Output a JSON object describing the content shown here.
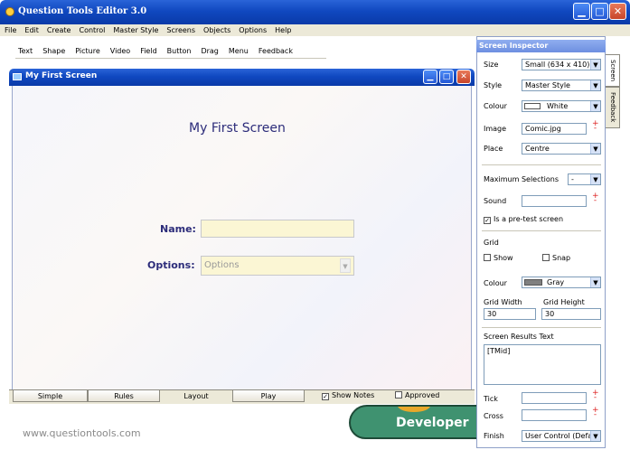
{
  "app": {
    "title": "Question Tools Editor 3.0",
    "menu": [
      "File",
      "Edit",
      "Create",
      "Control",
      "Master Style",
      "Screens",
      "Objects",
      "Options",
      "Help"
    ],
    "toolbar": [
      "Text",
      "Shape",
      "Picture",
      "Video",
      "Field",
      "Button",
      "Drag",
      "Menu",
      "Feedback"
    ]
  },
  "screen_window": {
    "title": "My First Screen",
    "heading": "My First Screen",
    "name_label": "Name:",
    "options_label": "Options:",
    "options_value": "Options",
    "tabs": [
      "Simple",
      "Rules",
      "Layout",
      "Play"
    ],
    "show_notes_label": "Show Notes",
    "show_notes_checked": true,
    "approved_label": "Approved",
    "approved_checked": false
  },
  "footer": {
    "url": "www.questiontools.com",
    "badge": "Developer"
  },
  "inspector": {
    "title": "Screen Inspector",
    "side_tabs": [
      "Screen",
      "Feedback"
    ],
    "size_label": "Size",
    "size_value": "Small (634 x 410)",
    "style_label": "Style",
    "style_value": "Master Style",
    "colour_label": "Colour",
    "colour_value": "White",
    "colour_swatch": "#ffffff",
    "image_label": "Image",
    "image_value": "Comic.jpg",
    "place_label": "Place",
    "place_value": "Centre",
    "max_sel_label": "Maximum Selections",
    "max_sel_value": "-",
    "sound_label": "Sound",
    "sound_value": "",
    "pretest_label": "Is a pre-test screen",
    "pretest_checked": true,
    "grid_label": "Grid",
    "grid_show_label": "Show",
    "grid_show_checked": false,
    "grid_snap_label": "Snap",
    "grid_snap_checked": false,
    "grid_colour_label": "Colour",
    "grid_colour_value": "Gray",
    "grid_colour_swatch": "#808080",
    "grid_width_label": "Grid Width",
    "grid_width_value": "30",
    "grid_height_label": "Grid Height",
    "grid_height_value": "30",
    "results_label": "Screen Results Text",
    "results_value": "[TMid]",
    "tick_label": "Tick",
    "tick_value": "",
    "cross_label": "Cross",
    "cross_value": "",
    "finish_label": "Finish",
    "finish_value": "User Control (Defa"
  },
  "colors": {
    "xp_blue": "#1048c0",
    "accent_label": "#2c2c7a"
  }
}
